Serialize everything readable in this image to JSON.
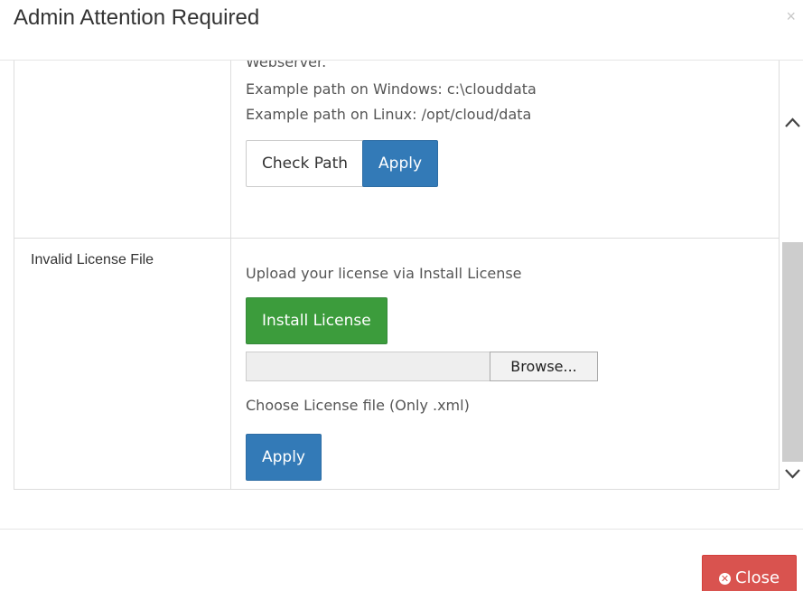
{
  "modal": {
    "title": "Admin Attention Required",
    "close_x": "×"
  },
  "issues": [
    {
      "label": "",
      "cut_text": "Webserver.",
      "lines": [
        "Example path on Windows: c:\\clouddata",
        "Example path on Linux: /opt/cloud/data"
      ],
      "buttons": {
        "check_path": "Check Path",
        "apply": "Apply"
      }
    },
    {
      "label": "Invalid License File",
      "description": "Upload your license via Install License",
      "install_button": "Install License",
      "browse_button": "Browse...",
      "file_hint": "Choose License file (Only .xml)",
      "apply": "Apply"
    }
  ],
  "footer": {
    "close_button": "Close",
    "close_icon": "times-circle-icon"
  },
  "colors": {
    "primary": "#337ab7",
    "success": "#3c9c3c",
    "danger": "#d9534f"
  }
}
